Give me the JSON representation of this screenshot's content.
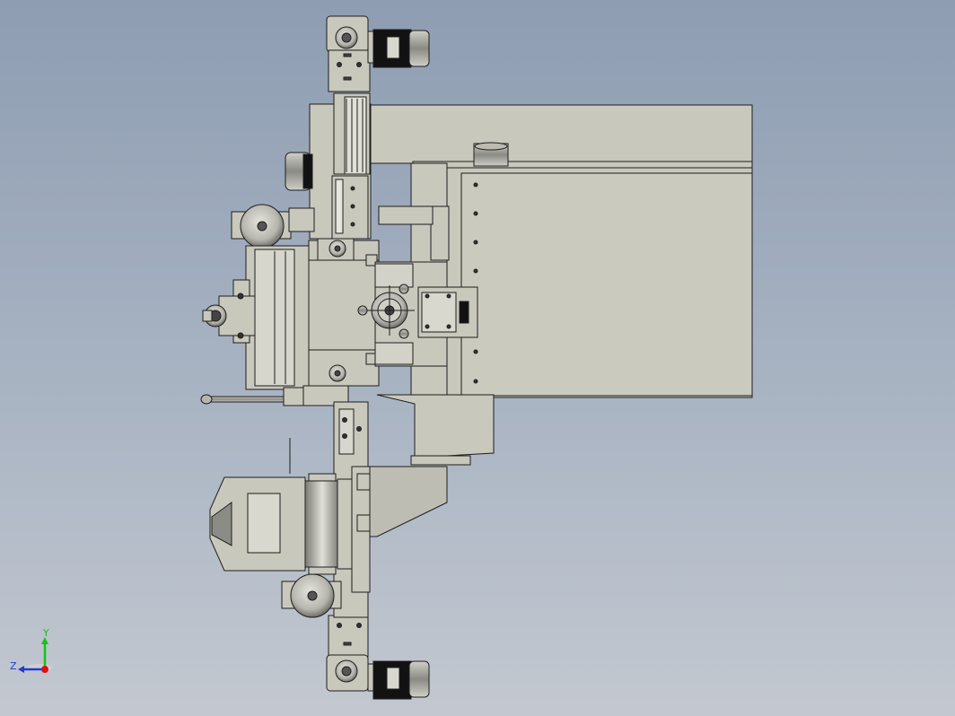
{
  "viewport": {
    "background_top": "#8e9db2",
    "background_bottom": "#c3c8d0",
    "part_fill": "#c8c8bc",
    "part_fill_dark": "#9c9c94",
    "edge_color": "#1e1e1e",
    "motor_color": "#111111"
  },
  "triad": {
    "y_label": "Y",
    "z_label": "Z",
    "y_color": "#17c21c",
    "x_color": "#1f3bd6",
    "origin_color": "#e01010"
  }
}
